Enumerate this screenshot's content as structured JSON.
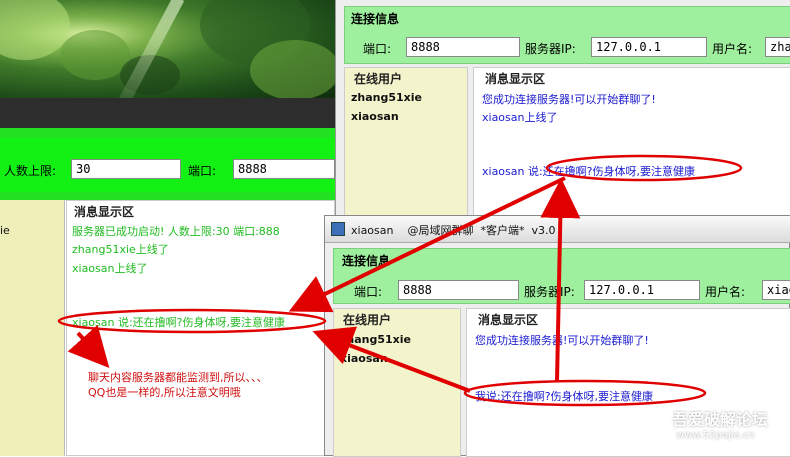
{
  "server": {
    "max_users_label": "人数上限:",
    "max_users_value": "30",
    "port_label": "端口:",
    "port_value": "8888",
    "msg_panel_title": "消息显示区",
    "messages": [
      "服务器已成功启动!  人数上限:30  端口:888",
      "zhang51xie上线了",
      "xiaosan上线了",
      "xiaosan 说:还在撸啊?伤身体呀,要注意健康"
    ],
    "user_list_fragment": "ie"
  },
  "client1": {
    "conn_title": "连接信息",
    "port_label": "端口:",
    "port_value": "8888",
    "server_ip_label": "服务器IP:",
    "server_ip_value": "127.0.0.1",
    "username_label": "用户名:",
    "username_value": "zha",
    "online_title": "在线用户",
    "online_users": [
      "zhang51xie",
      "xiaosan"
    ],
    "msg_panel_title": "消息显示区",
    "messages": [
      "您成功连接服务器!可以开始群聊了!",
      "xiaosan上线了",
      "xiaosan 说:还在撸啊?伤身体呀,要注意健康"
    ]
  },
  "client2": {
    "window_title": "xiaosan    @局域网群聊  *客户端*  v3.0",
    "conn_title": "连接信息",
    "port_label": "端口:",
    "port_value": "8888",
    "server_ip_label": "服务器IP:",
    "server_ip_value": "127.0.0.1",
    "username_label": "用户名:",
    "username_value": "xiaos",
    "online_title": "在线用户",
    "online_users": [
      "zhang51xie",
      "xiaosan"
    ],
    "msg_panel_title": "消息显示区",
    "messages": [
      "您成功连接服务器!可以开始群聊了!",
      "我说:还在撸啊?伤身体呀,要注意健康"
    ]
  },
  "annotation": {
    "line1": "聊天内容服务器都能监测到,所以、、、",
    "line2": "QQ也是一样的,所以注意文明哦"
  },
  "watermark": {
    "logo": "吾爱破解论坛",
    "url": "www.52pojie.cn"
  },
  "colors": {
    "server_text": "#22bb22",
    "client_text": "#1a1ad0",
    "annotation": "#e00000",
    "conn_panel": "#9ef09e"
  }
}
